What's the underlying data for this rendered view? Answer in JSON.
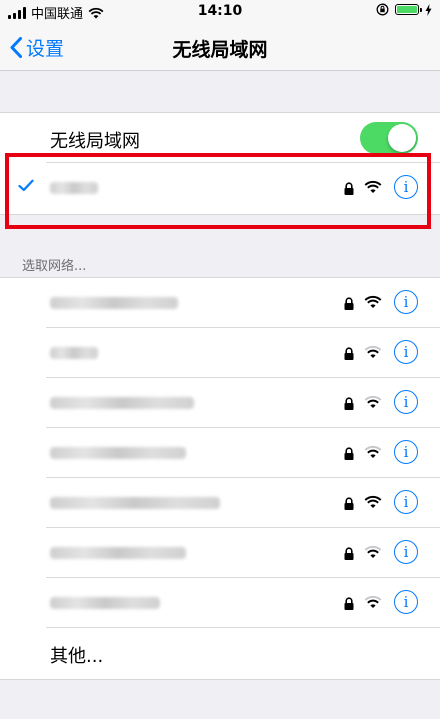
{
  "status_bar": {
    "carrier": "中国联通",
    "time": "14:10",
    "battery_color": "#4cd964"
  },
  "nav": {
    "back_label": "设置",
    "title": "无线局域网"
  },
  "wifi_toggle": {
    "label": "无线局域网",
    "on": true
  },
  "connected_network": {
    "secured": true,
    "signal": "full"
  },
  "section_header": "选取网络...",
  "networks": [
    {
      "secured": true,
      "signal": "full"
    },
    {
      "secured": true,
      "signal": "medium"
    },
    {
      "secured": true,
      "signal": "medium"
    },
    {
      "secured": true,
      "signal": "medium"
    },
    {
      "secured": true,
      "signal": "full"
    },
    {
      "secured": true,
      "signal": "medium"
    },
    {
      "secured": true,
      "signal": "medium"
    }
  ],
  "other_label": "其他...",
  "accent_color": "#007aff",
  "highlight_color": "#e60012"
}
